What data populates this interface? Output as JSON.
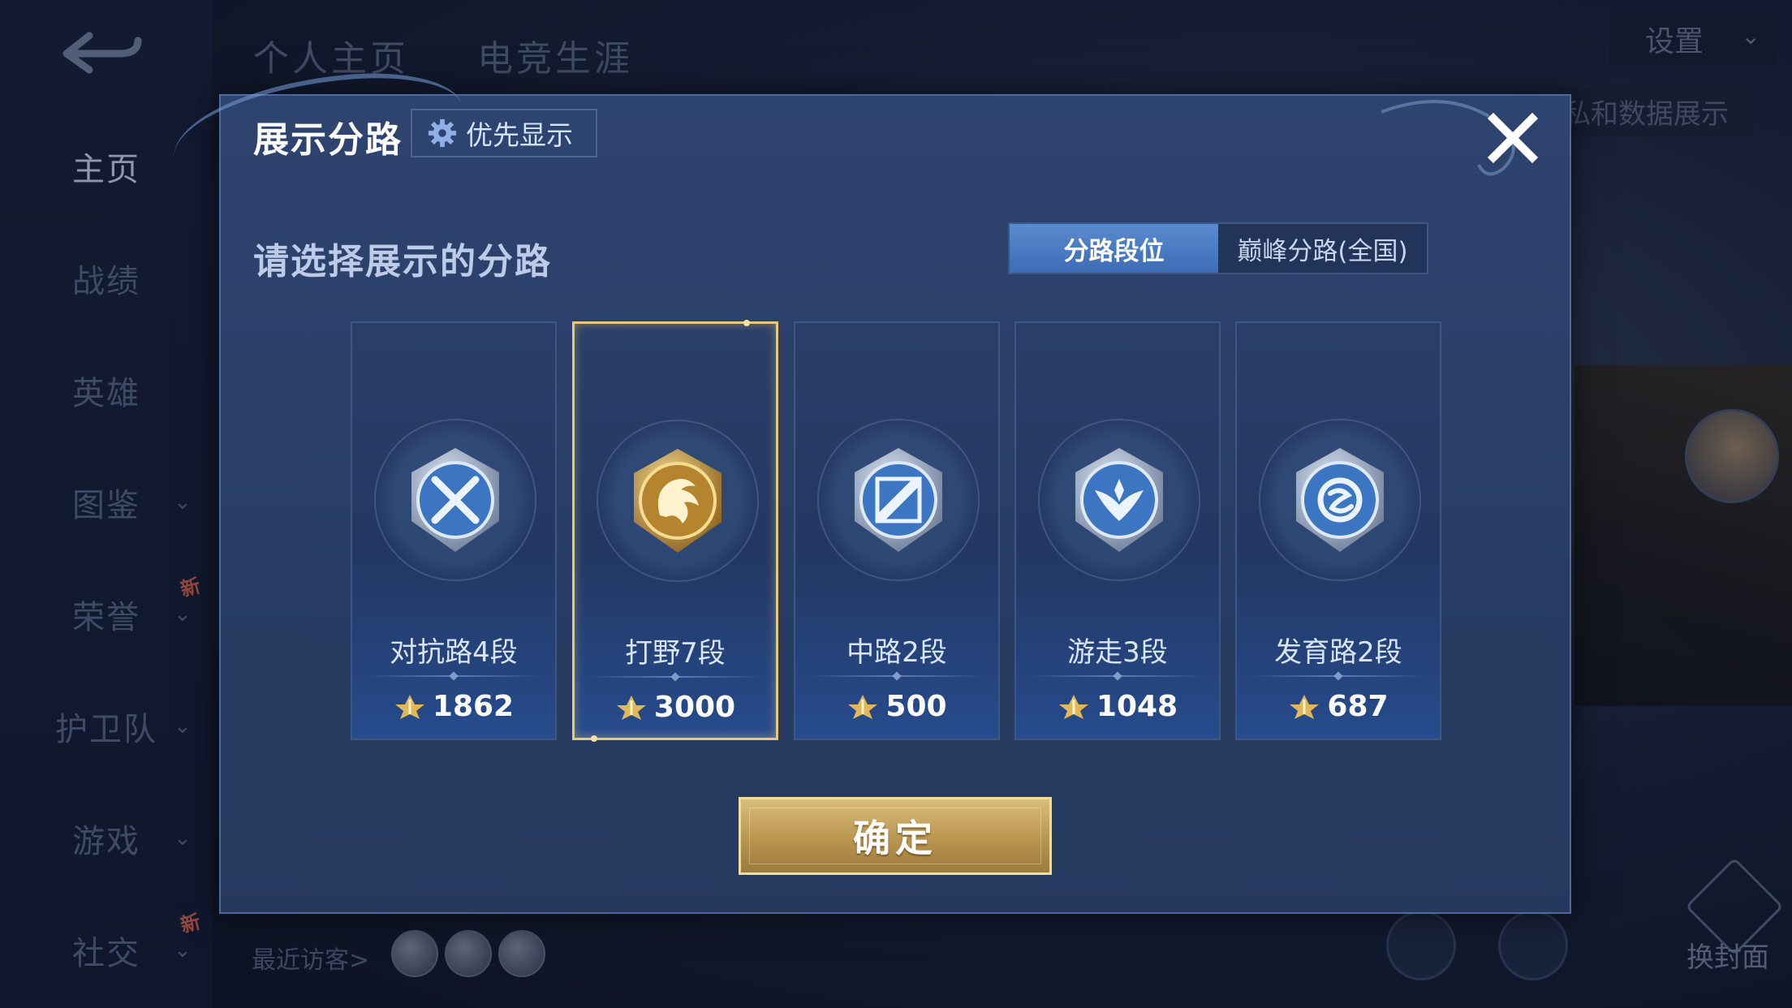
{
  "background": {
    "top_tabs": [
      "个人主页",
      "电竞生涯"
    ],
    "nav_items": [
      {
        "label": "主页",
        "active": true,
        "chevron": false,
        "new_badge": false
      },
      {
        "label": "战绩",
        "active": false,
        "chevron": false,
        "new_badge": false
      },
      {
        "label": "英雄",
        "active": false,
        "chevron": false,
        "new_badge": false
      },
      {
        "label": "图鉴",
        "active": false,
        "chevron": true,
        "new_badge": false
      },
      {
        "label": "荣誉",
        "active": false,
        "chevron": true,
        "new_badge": true
      },
      {
        "label": "护卫队",
        "active": false,
        "chevron": true,
        "new_badge": false
      },
      {
        "label": "游戏",
        "active": false,
        "chevron": true,
        "new_badge": false
      },
      {
        "label": "社交",
        "active": false,
        "chevron": true,
        "new_badge": true
      }
    ],
    "new_badge_text": "新",
    "settings_label": "设置",
    "tooltip_text": "隐私和数据展示",
    "recent_visitors_label": "最近访客>",
    "change_cover_label": "换封面"
  },
  "modal": {
    "title": "展示分路",
    "priority_label": "优先显示",
    "subtitle": "请选择展示的分路",
    "toggle": [
      {
        "label": "分路段位",
        "active": true
      },
      {
        "label": "巅峰分路(全国)",
        "active": false
      }
    ],
    "lanes": [
      {
        "name": "对抗路4段",
        "score": "1862",
        "emblem": "clash-lane-emblem-icon",
        "tier": "silver",
        "selected": false
      },
      {
        "name": "打野7段",
        "score": "3000",
        "emblem": "jungle-dragon-emblem-icon",
        "tier": "gold",
        "selected": true
      },
      {
        "name": "中路2段",
        "score": "500",
        "emblem": "mid-lane-emblem-icon",
        "tier": "silver",
        "selected": false
      },
      {
        "name": "游走3段",
        "score": "1048",
        "emblem": "roam-wings-emblem-icon",
        "tier": "silver",
        "selected": false
      },
      {
        "name": "发育路2段",
        "score": "687",
        "emblem": "farm-lane-emblem-icon",
        "tier": "silver",
        "selected": false
      }
    ],
    "confirm_label": "确定"
  },
  "colors": {
    "modal_bg": "#2a3f67",
    "selected_border": "#e8c778",
    "confirm_gold": "#b9954f",
    "toggle_active": "#4d7bc4",
    "score_icon_gold": "#e0b85a"
  }
}
